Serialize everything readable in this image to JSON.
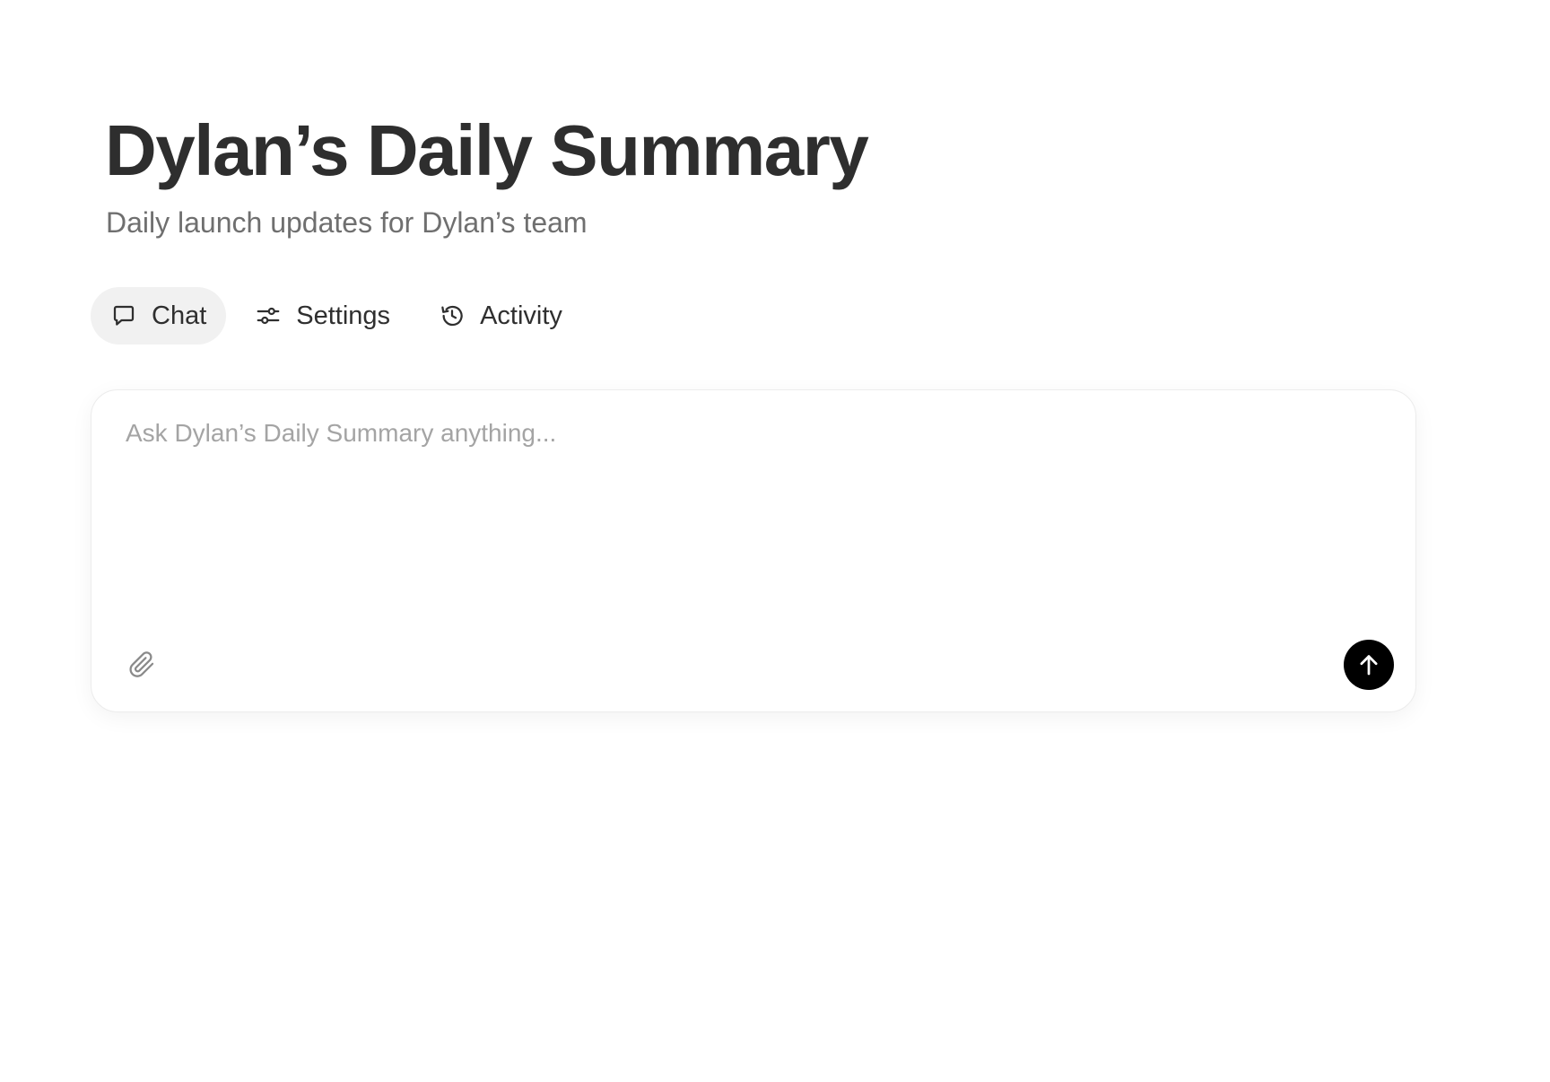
{
  "header": {
    "title": "Dylan’s Daily Summary",
    "subtitle": "Daily launch updates for Dylan’s team"
  },
  "tabs": [
    {
      "label": "Chat",
      "icon": "chat-bubble-icon",
      "active": true
    },
    {
      "label": "Settings",
      "icon": "sliders-icon",
      "active": false
    },
    {
      "label": "Activity",
      "icon": "history-clock-icon",
      "active": false
    }
  ],
  "composer": {
    "placeholder": "Ask Dylan’s Daily Summary anything...",
    "value": "",
    "attach_icon": "paperclip-icon",
    "send_icon": "arrow-up-icon"
  },
  "colors": {
    "title": "#2e2e2e",
    "subtitle": "#6f6f6f",
    "active_tab_bg": "#f1f1f1",
    "send_button_bg": "#000000"
  }
}
